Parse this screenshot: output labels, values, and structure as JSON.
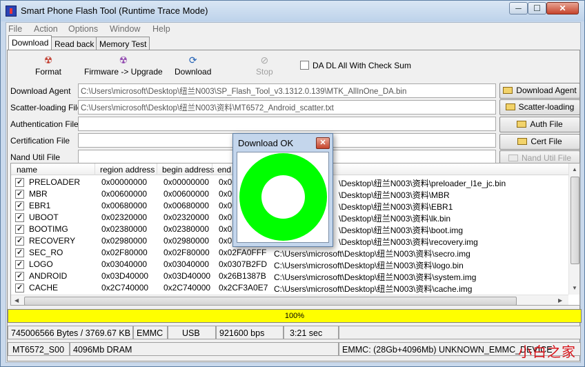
{
  "window": {
    "title": "Smart Phone Flash Tool (Runtime Trace Mode)",
    "min": "─",
    "max": "☐",
    "close": "✕"
  },
  "menu": [
    "File",
    "Action",
    "Options",
    "Window",
    "Help"
  ],
  "tabs": [
    "Download",
    "Read back",
    "Memory Test"
  ],
  "toolbar": {
    "format": "Format",
    "firmware_upgrade": "Firmware -> Upgrade",
    "download": "Download",
    "stop": "Stop",
    "checksum_label": "DA DL All With Check Sum"
  },
  "fields": [
    {
      "label": "Download Agent",
      "value": "C:\\Users\\microsoft\\Desktop\\纽兰N003\\SP_Flash_Tool_v3.1312.0.139\\MTK_AllInOne_DA.bin",
      "button": "Download Agent",
      "disabled": false
    },
    {
      "label": "Scatter-loading File",
      "value": "C:\\Users\\microsoft\\Desktop\\纽兰N003\\资料\\MT6572_Android_scatter.txt",
      "button": "Scatter-loading",
      "disabled": false
    },
    {
      "label": "Authentication File",
      "value": "",
      "button": "Auth File",
      "disabled": false
    },
    {
      "label": "Certification File",
      "value": "",
      "button": "Cert File",
      "disabled": false
    },
    {
      "label": "Nand Util File",
      "value": "",
      "button": "Nand Util File",
      "disabled": true
    }
  ],
  "table": {
    "headers": [
      "name",
      "region address",
      "begin address",
      "end a"
    ],
    "rows": [
      {
        "name": "PRELOADER",
        "region": "0x00000000",
        "begin": "0x00000000",
        "end": "0x00",
        "location": "\\Desktop\\纽兰N003\\资料\\preloader_l1e_jc.bin"
      },
      {
        "name": "MBR",
        "region": "0x00600000",
        "begin": "0x00600000",
        "end": "0x00",
        "location": "\\Desktop\\纽兰N003\\资料\\MBR"
      },
      {
        "name": "EBR1",
        "region": "0x00680000",
        "begin": "0x00680000",
        "end": "0x00",
        "location": "\\Desktop\\纽兰N003\\资料\\EBR1"
      },
      {
        "name": "UBOOT",
        "region": "0x02320000",
        "begin": "0x02320000",
        "end": "0x02",
        "location": "\\Desktop\\纽兰N003\\资料\\lk.bin"
      },
      {
        "name": "BOOTIMG",
        "region": "0x02380000",
        "begin": "0x02380000",
        "end": "0x02",
        "location": "\\Desktop\\纽兰N003\\资料\\boot.img"
      },
      {
        "name": "RECOVERY",
        "region": "0x02980000",
        "begin": "0x02980000",
        "end": "0x02",
        "location": "\\Desktop\\纽兰N003\\资料\\recovery.img"
      },
      {
        "name": "SEC_RO",
        "region": "0x02F80000",
        "begin": "0x02F80000",
        "end": "0x02FA0FFF",
        "location": "C:\\Users\\microsoft\\Desktop\\纽兰N003\\资料\\secro.img"
      },
      {
        "name": "LOGO",
        "region": "0x03040000",
        "begin": "0x03040000",
        "end": "0x0307B2FD",
        "location": "C:\\Users\\microsoft\\Desktop\\纽兰N003\\资料\\logo.bin"
      },
      {
        "name": "ANDROID",
        "region": "0x03D40000",
        "begin": "0x03D40000",
        "end": "0x26B1387B",
        "location": "C:\\Users\\microsoft\\Desktop\\纽兰N003\\资料\\system.img"
      },
      {
        "name": "CACHE",
        "region": "0x2C740000",
        "begin": "0x2C740000",
        "end": "0x2CF3A0E7",
        "location": "C:\\Users\\microsoft\\Desktop\\纽兰N003\\资料\\cache.img"
      }
    ]
  },
  "progress": {
    "value": 1.0,
    "text": "100%",
    "color": "#ffff00"
  },
  "status": {
    "bytes": "745006566 Bytes / 3769.67 KB",
    "storage": "EMMC",
    "port": "USB",
    "baud": "921600 bps",
    "time": "3:21 sec",
    "chip": "MT6572_S00",
    "dram": "4096Mb DRAM",
    "emmc_info": "EMMC: (28Gb+4096Mb) UNKNOWN_EMMC_DEVICE"
  },
  "watermark": "小白之家",
  "dialog": {
    "title": "Download OK",
    "close": "✕",
    "ring_color": "#00ff00"
  }
}
